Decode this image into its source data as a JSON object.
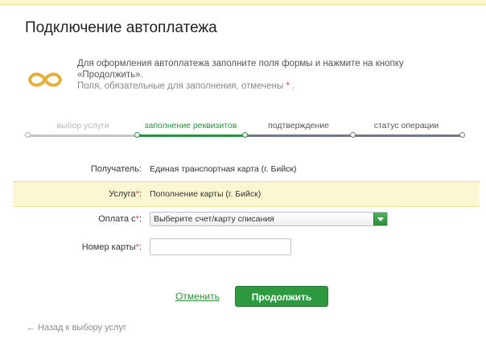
{
  "page": {
    "title": "Подключение автоплатежа"
  },
  "intro": {
    "line1": "Для оформления автоплатежа заполните поля формы и нажмите на кнопку «Продолжить».",
    "required_note": "Поля, обязательные для заполнения, отмечены",
    "required_mark": "*",
    "required_end": "."
  },
  "steps": [
    {
      "label": "выбор услуги",
      "state": "past"
    },
    {
      "label": "заполнение реквизитов",
      "state": "current"
    },
    {
      "label": "подтверждение",
      "state": "future"
    },
    {
      "label": "статус операции",
      "state": "future"
    }
  ],
  "form": {
    "recipient_label": "Получатель:",
    "recipient_value": "Единая транспортная карта (г. Бийск)",
    "service_label": "Услуга",
    "service_value": "Пополнение карты (г. Бийск)",
    "payfrom_label": "Оплата с",
    "payfrom_value": "Выберите счет/карту списания",
    "card_label": "Номер карты",
    "card_value": "",
    "required_mark": "*",
    "colon": ":"
  },
  "actions": {
    "cancel": "Отменить",
    "continue": "Продолжить"
  },
  "back_link": {
    "arrow": "←",
    "label": "Назад к выбору услуг"
  },
  "colors": {
    "accent_green": "#2e9a40",
    "highlight_row": "#fbf7d2",
    "logo_gold": "#e2b13c"
  }
}
